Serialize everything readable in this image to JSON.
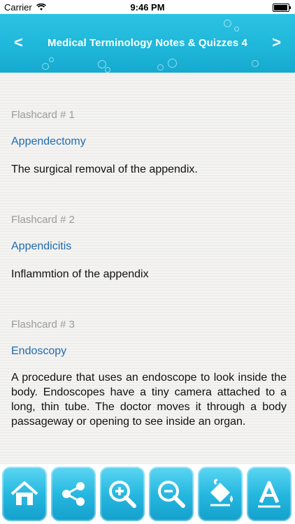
{
  "status": {
    "carrier": "Carrier",
    "time": "9:46 PM"
  },
  "nav": {
    "title": "Medical Terminology Notes & Quizzes 4",
    "prev": "<",
    "next": ">"
  },
  "cards": [
    {
      "label": "Flashcard # 1",
      "term": "Appendectomy",
      "definition": "The surgical removal of the appendix."
    },
    {
      "label": "Flashcard # 2",
      "term": "Appendicitis",
      "definition": "Inflammtion of the appendix"
    },
    {
      "label": "Flashcard # 3",
      "term": "Endoscopy",
      "definition": "A procedure that uses an endoscope to look inside the body. Endoscopes have a tiny camera attached to a long, thin tube. The doctor moves it through a body passageway or opening to see inside an organ."
    }
  ],
  "toolbar": {
    "buttons": [
      {
        "icon": "home-icon"
      },
      {
        "icon": "share-icon"
      },
      {
        "icon": "zoom-in-icon"
      },
      {
        "icon": "zoom-out-icon"
      },
      {
        "icon": "paint-bucket-icon"
      },
      {
        "icon": "font-icon"
      }
    ]
  },
  "colors": {
    "accent": "#1eb6d9",
    "term": "#1f6cb0",
    "label": "#9b9b9b"
  }
}
